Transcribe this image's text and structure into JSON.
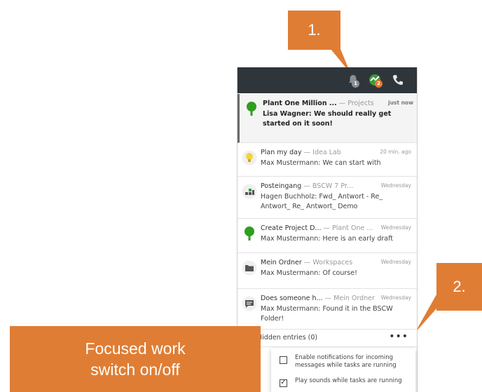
{
  "topbar": {
    "bell_badge": "1",
    "feed_badge": "2"
  },
  "notifications": [
    {
      "title": "Plant One Million ...",
      "context": "Projects",
      "time": "just now",
      "message": "Lisa Wagner: We should really get started on it soon!",
      "icon": "tree-icon",
      "unread": true
    },
    {
      "title": "Plan my day",
      "context": "Idea Lab",
      "time": "20 min. ago",
      "message": "Max Mustermann: We can start with",
      "icon": "lightbulb-icon",
      "unread": false
    },
    {
      "title": "Posteingang",
      "context": "BSCW 7 Pr...",
      "time": "Wednesday",
      "message": "Hagen Buchholz: Fwd_ Antwort - Re_ Antwort_ Re_ Antwort_ Demo",
      "icon": "inbox-icon",
      "unread": false
    },
    {
      "title": "Create Project D...",
      "context": "Plant One ...",
      "time": "Wednesday",
      "message": "Max Mustermann: Here is an early draft",
      "icon": "tree-icon",
      "unread": false
    },
    {
      "title": "Mein Ordner",
      "context": "Workspaces",
      "time": "Wednesday",
      "message": "Max Mustermann: Of course!",
      "icon": "folder-icon",
      "unread": false
    },
    {
      "title": "Does someone h...",
      "context": "Mein Ordner",
      "time": "Wednesday",
      "message": "Max Mustermann: Found it in the BSCW Folder!",
      "icon": "comment-icon",
      "unread": false
    }
  ],
  "separator": "—",
  "hidden_entries": "Hidden entries (0)",
  "more_label": "•••",
  "options": [
    {
      "label": "Enable notifications for incoming messages while tasks are running",
      "checked": false
    },
    {
      "label": "Play sounds while tasks are running",
      "checked": true
    }
  ],
  "callouts": {
    "one": "1.",
    "two": "2.",
    "focused_line1": "Focused work",
    "focused_line2": "switch on/off"
  },
  "colors": {
    "topbar": "#2f363b",
    "callout": "#e07d34",
    "tree": "#2e9e1f",
    "badge_orange": "#e8772e"
  }
}
